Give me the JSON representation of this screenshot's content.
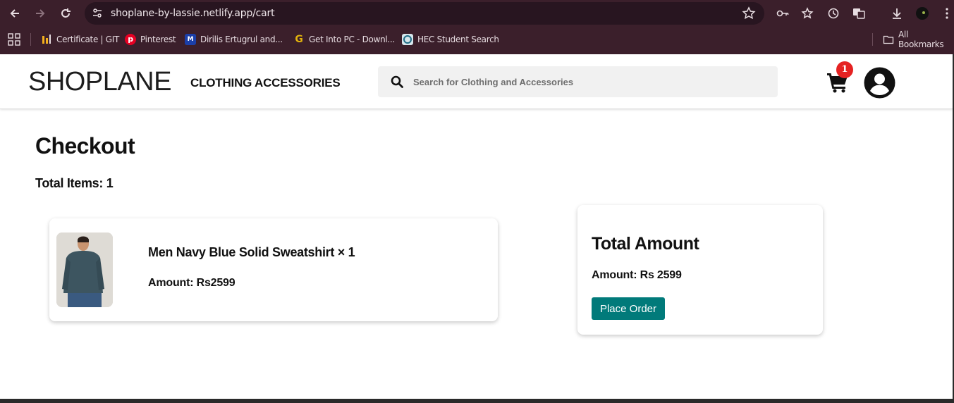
{
  "browser": {
    "url": "shoplane-by-lassie.netlify.app/cart",
    "bookmarks": [
      {
        "label": "Certificate | GIT",
        "icon": "chart-bars-icon"
      },
      {
        "label": "Pinterest",
        "icon": "pinterest-icon"
      },
      {
        "label": "Dirilis Ertugrul and...",
        "icon": "site-logo-icon"
      },
      {
        "label": "Get Into PC - Downl...",
        "icon": "g-logo-icon"
      },
      {
        "label": "HEC Student Search",
        "icon": "hec-logo-icon"
      }
    ],
    "all_bookmarks": "All Bookmarks"
  },
  "header": {
    "logo_bold": "SHOP",
    "logo_rest": "LANE",
    "nav": [
      "CLOTHING",
      "ACCESSORIES"
    ],
    "search_placeholder": "Search for Clothing and Accessories",
    "cart_count": "1"
  },
  "checkout": {
    "title": "Checkout",
    "total_items": "Total Items: 1",
    "items": [
      {
        "name": "Men Navy Blue Solid Sweatshirt × 1",
        "amount": "Amount: Rs2599"
      }
    ],
    "summary": {
      "title": "Total Amount",
      "amount": "Amount: Rs 2599",
      "button": "Place Order"
    }
  },
  "colors": {
    "browser_bg": "#3b1f2b",
    "accent_button": "#017a7a",
    "badge": "#e52222"
  }
}
